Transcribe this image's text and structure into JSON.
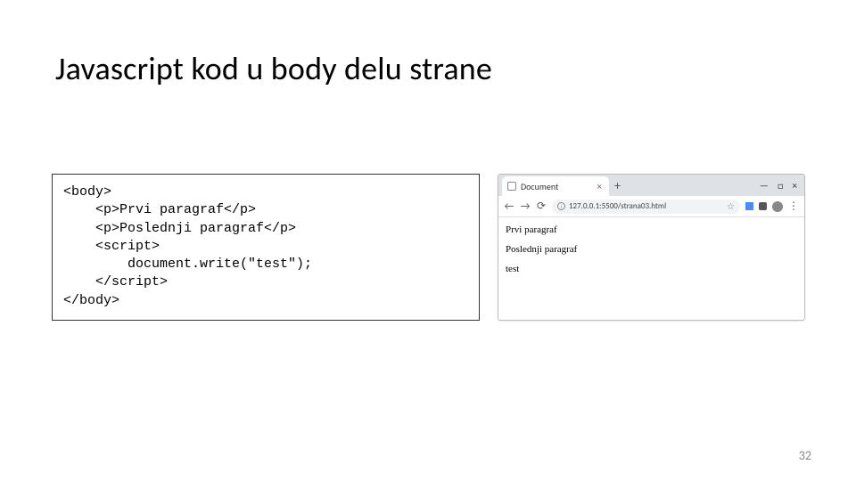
{
  "slide": {
    "title": "Javascript kod u body delu strane",
    "page_number": "32"
  },
  "code_block": {
    "l1": "<body>",
    "l2": "    <p>Prvi paragraf</p>",
    "l3": "    <p>Poslednji paragraf</p>",
    "l4": "    <script>",
    "l5": "        document.write(\"test\");",
    "l6": "    </scr",
    "l6b": "ipt>",
    "l7": "</body>"
  },
  "browser": {
    "tab_title": "Document",
    "tab_close": "×",
    "new_tab": "+",
    "win_min": "—",
    "win_max": "□",
    "win_close": "×",
    "nav_back": "←",
    "nav_fwd": "→",
    "nav_reload": "⟳",
    "info_i": "i",
    "url": "127.0.0.1:5500/strana03.html",
    "star": "☆",
    "kebab": "⋮",
    "content": {
      "p1": "Prvi paragraf",
      "p2": "Poslednji paragraf",
      "p3": "test"
    }
  }
}
